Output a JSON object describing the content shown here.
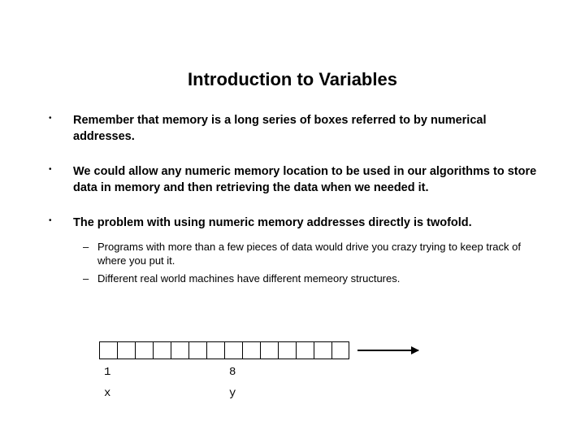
{
  "title": "Introduction to Variables",
  "bullets": [
    {
      "text": "Remember that memory is a long series of boxes referred to by numerical addresses."
    },
    {
      "text": "We could allow any numeric memory location to be used in our algorithms to store data in memory and then retrieving the data when we needed it."
    },
    {
      "text": "The problem with using numeric memory addresses directly is twofold.",
      "sub": [
        "Programs with more than a few pieces of data would drive you crazy trying to keep track of where you put it.",
        "Different real world machines have different memeory structures."
      ]
    }
  ],
  "diagram": {
    "cell_count": 14,
    "labels_row1": {
      "left": "1",
      "right": "8"
    },
    "labels_row2": {
      "left": "x",
      "right": "y"
    }
  }
}
